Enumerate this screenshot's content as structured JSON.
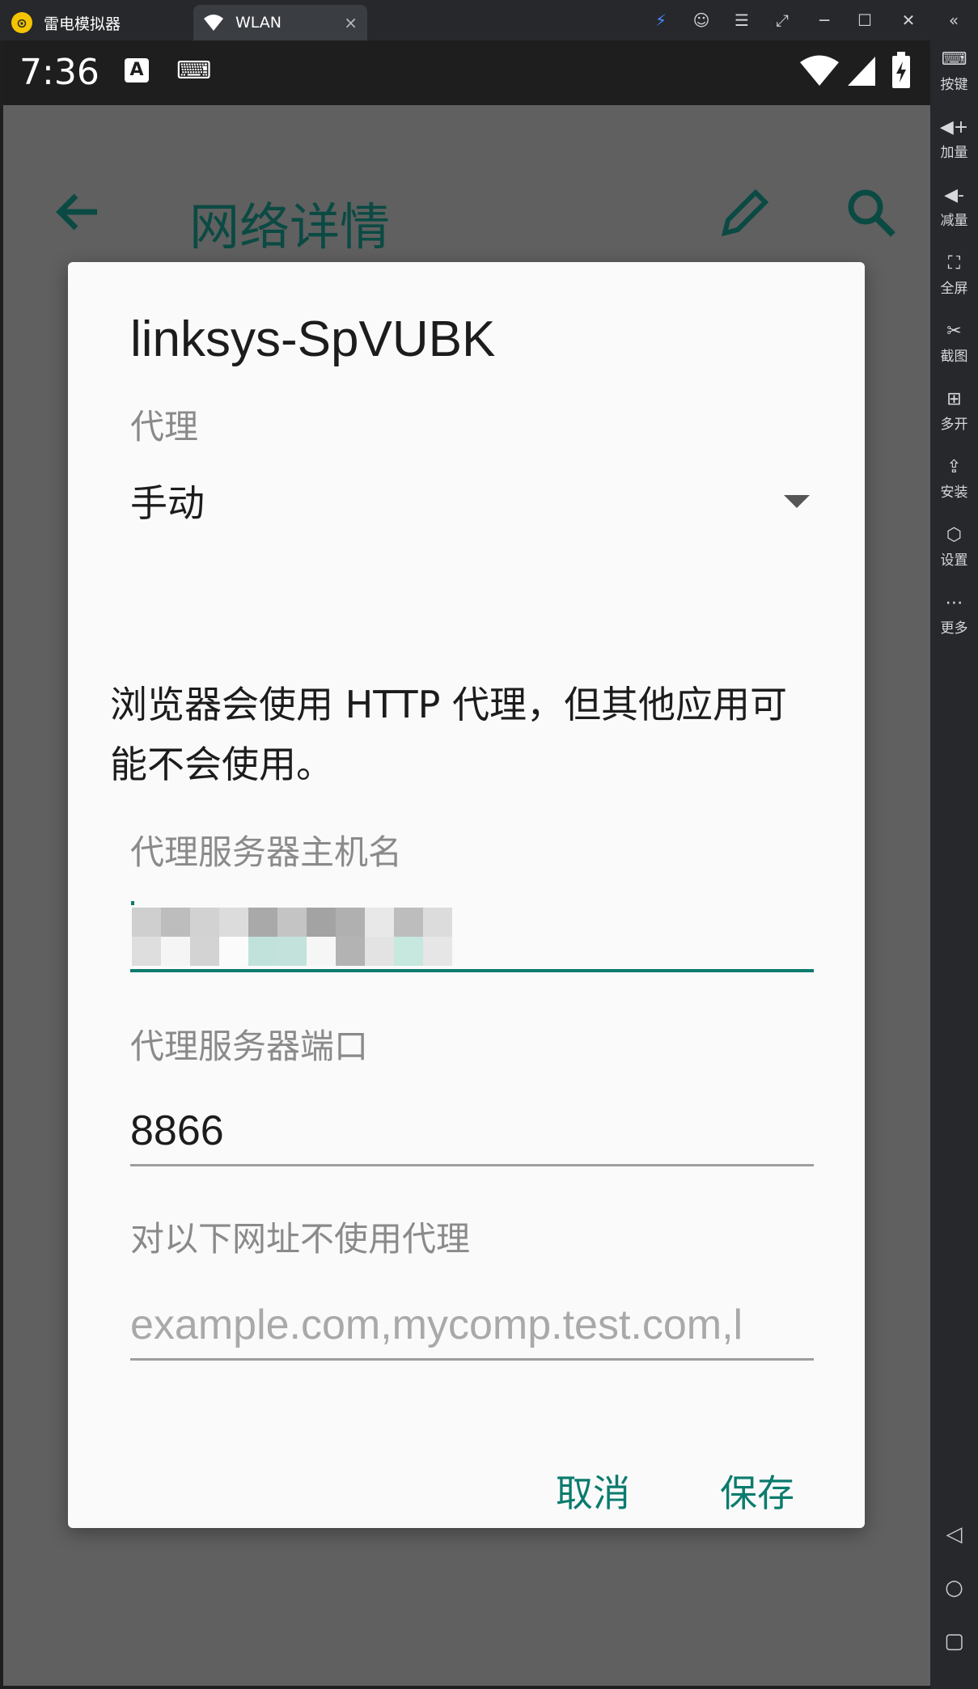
{
  "emulator": {
    "app_name": "雷电模拟器",
    "active_tab": "WLAN",
    "tab_close": "×",
    "window_buttons": [
      "⚡",
      "☺",
      "☰",
      "⤢",
      "─",
      "☐",
      "✕",
      "«"
    ],
    "sidebar": [
      {
        "icon": "⌨",
        "label": "按键"
      },
      {
        "icon": "◀+",
        "label": "加量"
      },
      {
        "icon": "◀-",
        "label": "减量"
      },
      {
        "icon": "⛶",
        "label": "全屏"
      },
      {
        "icon": "✂",
        "label": "截图"
      },
      {
        "icon": "⊞",
        "label": "多开"
      },
      {
        "icon": "⇪",
        "label": "安装"
      },
      {
        "icon": "⬡",
        "label": "设置"
      },
      {
        "icon": "⋯",
        "label": "更多"
      }
    ],
    "nav": {
      "back": "◁",
      "home": "○",
      "recents": "▢"
    }
  },
  "status_bar": {
    "time": "7:36",
    "notification_a": "A",
    "keyboard_icon": "⌨"
  },
  "app_bar": {
    "title": "网络详情"
  },
  "dialog": {
    "title": "linksys-SpVUBK",
    "proxy_label": "代理",
    "proxy_value": "手动",
    "info_text": "浏览器会使用 HTTP 代理，但其他应用可能不会使用。",
    "hostname_label": "代理服务器主机名",
    "hostname_value": "",
    "port_label": "代理服务器端口",
    "port_value": "8866",
    "bypass_label": "对以下网址不使用代理",
    "bypass_placeholder": "example.com,mycomp.test.com,l",
    "cancel_label": "取消",
    "save_label": "保存"
  },
  "colors": {
    "accent": "#0b7b6d",
    "dialog_bg": "#fafafa",
    "scrim": "#606060"
  }
}
